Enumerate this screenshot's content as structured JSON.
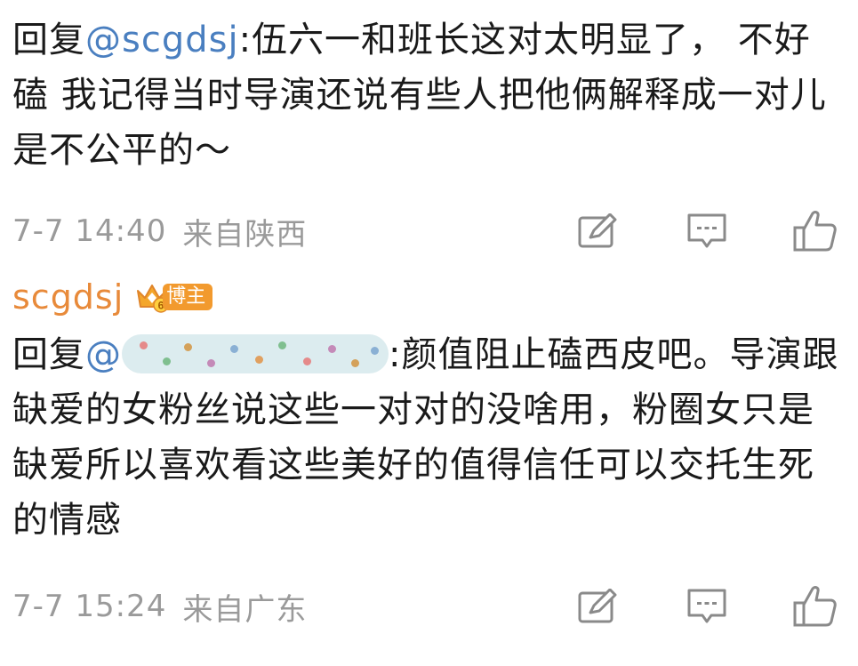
{
  "comments": [
    {
      "reply_prefix": "回复",
      "mention": "@scgdsj",
      "text_after_mention": ":伍六一和班长这对太明显了， 不好磕 我记得当时导演还说有些人把他俩解释成一对儿是不公平的～",
      "time": "7-7 14:40",
      "location": "来自陕西"
    },
    {
      "author": "scgdsj",
      "author_badge_label": "博主",
      "badge_level": "6",
      "reply_prefix": "回复",
      "mention_at": "@",
      "mention_colon": ":",
      "text_after_mention": "颜值阻止磕西皮吧。导演跟缺爱的女粉丝说这些一对对的没啥用，粉圈女只是缺爱所以喜欢看这些美好的值得信任可以交托生死的情感",
      "time": "7-7 15:24",
      "location": "来自广东"
    }
  ],
  "icons": {
    "edit": "edit-icon",
    "comment": "comment-icon",
    "like": "like-icon",
    "crown": "crown-vip-icon"
  },
  "colors": {
    "mention": "#4a7fc0",
    "author": "#e88a3a",
    "badge": "#f29a2e",
    "meta": "#9a9a9a",
    "text": "#1a1a1a"
  }
}
